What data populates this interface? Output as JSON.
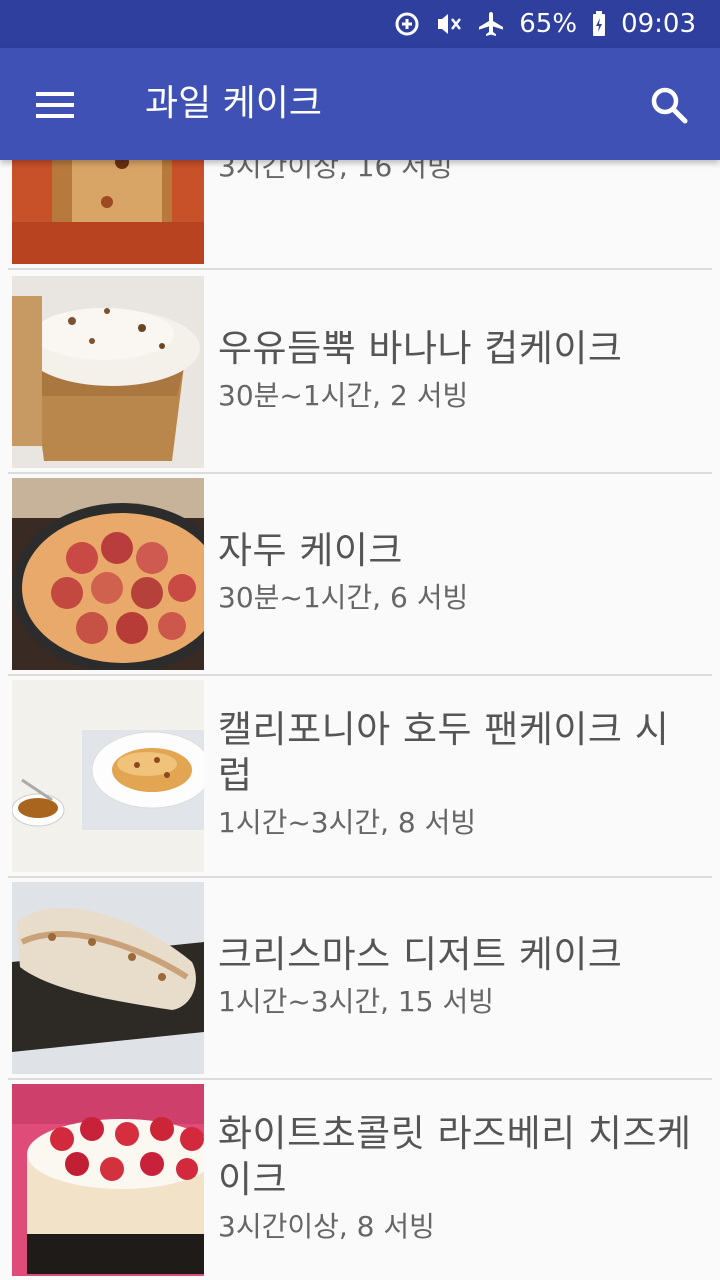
{
  "status_bar": {
    "battery": "65%",
    "time": "09:03",
    "icons": [
      "data-saver-icon",
      "vibrate-mute-icon",
      "airplane-icon",
      "battery-charging-icon"
    ]
  },
  "app_bar": {
    "title": "과일 케이크",
    "menu_icon": "hamburger-menu-icon",
    "search_icon": "search-icon",
    "color": "#3f51b5",
    "status_color": "#2f3f9e"
  },
  "recipes": [
    {
      "title": "",
      "meta": "3시간이상, 16 서빙"
    },
    {
      "title": "우유듬뿍 바나나 컵케이크",
      "meta": "30분~1시간, 2 서빙"
    },
    {
      "title": "자두 케이크",
      "meta": "30분~1시간, 6 서빙"
    },
    {
      "title": "캘리포니아 호두 팬케이크 시럽",
      "meta": "1시간~3시간, 8 서빙"
    },
    {
      "title": "크리스마스 디저트 케이크",
      "meta": "1시간~3시간, 15 서빙"
    },
    {
      "title": "화이트초콜릿 라즈베리 치즈케이크",
      "meta": "3시간이상, 8 서빙"
    }
  ]
}
